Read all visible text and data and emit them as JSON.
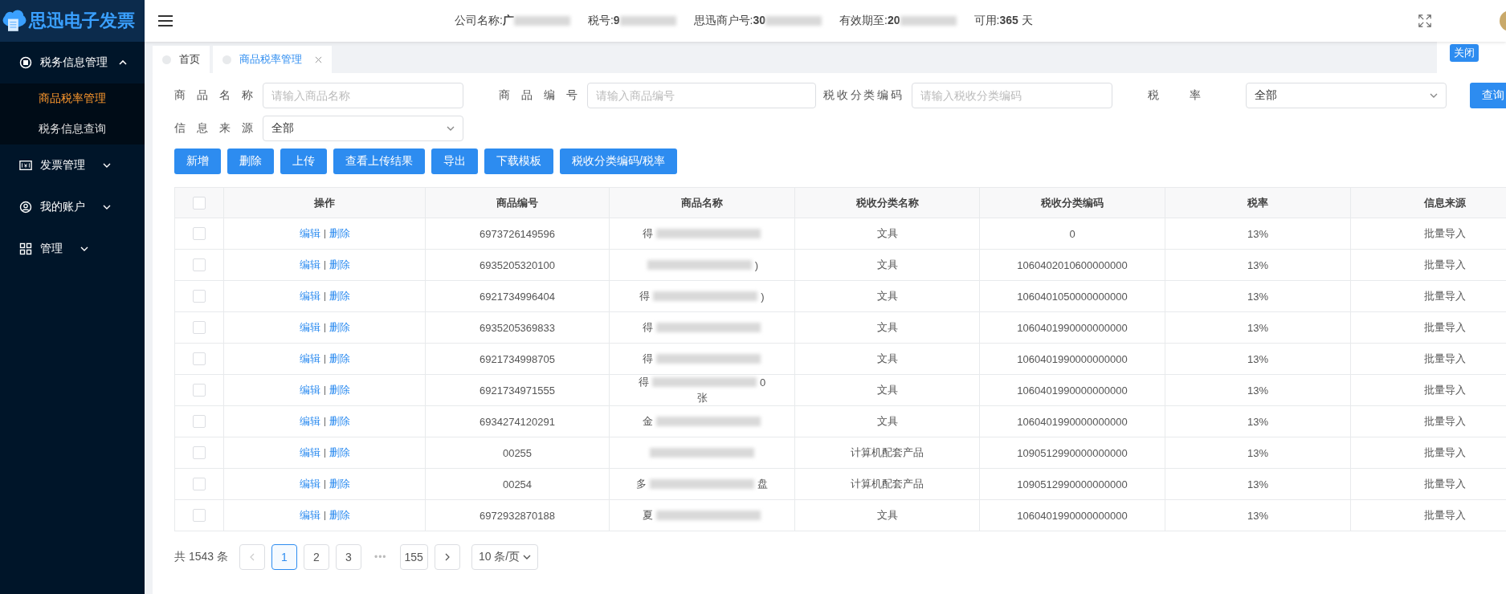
{
  "sidebar": {
    "logo": "思迅电子发票",
    "menu": [
      {
        "label": "税务信息管理",
        "kind": "tax",
        "expanded": true,
        "children": [
          {
            "label": "商品税率管理",
            "selected": true
          },
          {
            "label": "税务信息查询",
            "selected": false
          }
        ]
      },
      {
        "label": "发票管理",
        "kind": "invoice",
        "expanded": false
      },
      {
        "label": "我的账户",
        "kind": "account",
        "expanded": false
      },
      {
        "label": "管理",
        "kind": "grid",
        "expanded": false
      }
    ]
  },
  "header": {
    "info": [
      {
        "label": "公司名称:",
        "value": "广",
        "redacted": true
      },
      {
        "label": "税号:",
        "value": "9",
        "redacted": true
      },
      {
        "label": "思迅商户号:",
        "value": "30",
        "redacted": true
      },
      {
        "label": "有效期至:",
        "value": "20",
        "redacted": true
      },
      {
        "label": "可用:",
        "value": "365",
        "suffix": "天",
        "redacted": false
      }
    ]
  },
  "tabs": [
    {
      "label": "首页",
      "selected": false,
      "closable": false
    },
    {
      "label": "商品税率管理",
      "selected": true,
      "closable": true
    }
  ],
  "close_all_button": "关闭",
  "filters": [
    {
      "label": "商品名称",
      "kind": "input",
      "placeholder": "请输入商品名称"
    },
    {
      "label": "商品编号",
      "kind": "input",
      "placeholder": "请输入商品编号"
    },
    {
      "label": "税收分类编码",
      "kind": "input",
      "placeholder": "请输入税收分类编码"
    },
    {
      "label": "税率",
      "kind": "select",
      "value": "全部"
    },
    {
      "label": "信息来源",
      "kind": "select",
      "value": "全部"
    }
  ],
  "search_button": "查询",
  "actions": [
    "新增",
    "删除",
    "上传",
    "查看上传结果",
    "导出",
    "下载模板",
    "税收分类编码/税率"
  ],
  "table": {
    "all_checked": false,
    "columns": [
      "操作",
      "商品编号",
      "商品名称",
      "税收分类名称",
      "税收分类编码",
      "税率",
      "信息来源"
    ],
    "rows": [
      {
        "checked": false,
        "ops": [
          "编辑",
          "删除"
        ],
        "code": "6973726149596",
        "name_start": "得",
        "name_redacted": true,
        "category": "文具",
        "tax_code": "0",
        "rate": "13%",
        "source": "批量导入"
      },
      {
        "checked": false,
        "ops": [
          "编辑",
          "删除"
        ],
        "code": "6935205320100",
        "name_end": ")",
        "name_redacted": true,
        "category": "文具",
        "tax_code": "1060402010600000000",
        "rate": "13%",
        "source": "批量导入"
      },
      {
        "checked": false,
        "ops": [
          "编辑",
          "删除"
        ],
        "code": "6921734996404",
        "name_start": "得",
        "name_end": ")",
        "name_redacted": true,
        "category": "文具",
        "tax_code": "1060401050000000000",
        "rate": "13%",
        "source": "批量导入"
      },
      {
        "checked": false,
        "ops": [
          "编辑",
          "删除"
        ],
        "code": "6935205369833",
        "name_start": "得",
        "name_redacted": true,
        "category": "文具",
        "tax_code": "1060401990000000000",
        "rate": "13%",
        "source": "批量导入"
      },
      {
        "checked": false,
        "ops": [
          "编辑",
          "删除"
        ],
        "code": "6921734998705",
        "name_start": "得",
        "name_redacted": true,
        "category": "文具",
        "tax_code": "1060401990000000000",
        "rate": "13%",
        "source": "批量导入"
      },
      {
        "checked": false,
        "ops": [
          "编辑",
          "删除"
        ],
        "code": "6921734971555",
        "name_start": "得",
        "name_end": "0",
        "name_line2": "张",
        "name_redacted": true,
        "category": "文具",
        "tax_code": "1060401990000000000",
        "rate": "13%",
        "source": "批量导入"
      },
      {
        "checked": false,
        "ops": [
          "编辑",
          "删除"
        ],
        "code": "6934274120291",
        "name_start": "金",
        "name_redacted": true,
        "category": "文具",
        "tax_code": "1060401990000000000",
        "rate": "13%",
        "source": "批量导入"
      },
      {
        "checked": false,
        "ops": [
          "编辑",
          "删除"
        ],
        "code": "00255",
        "name_redacted": true,
        "category": "计算机配套产品",
        "tax_code": "1090512990000000000",
        "rate": "13%",
        "source": "批量导入"
      },
      {
        "checked": false,
        "ops": [
          "编辑",
          "删除"
        ],
        "code": "00254",
        "name_start": "多",
        "name_end": "盘",
        "name_redacted": true,
        "category": "计算机配套产品",
        "tax_code": "1090512990000000000",
        "rate": "13%",
        "source": "批量导入"
      },
      {
        "checked": false,
        "ops": [
          "编辑",
          "删除"
        ],
        "code": "6972932870188",
        "name_start": "夏",
        "name_redacted": true,
        "category": "文具",
        "tax_code": "1060401990000000000",
        "rate": "13%",
        "source": "批量导入"
      }
    ]
  },
  "pagination": {
    "total": "共 1543 条",
    "prev_disabled": true,
    "pages": [
      {
        "label": "1",
        "kind": "page",
        "selected": true
      },
      {
        "label": "2",
        "kind": "page",
        "selected": false
      },
      {
        "label": "3",
        "kind": "page",
        "selected": false
      },
      {
        "label": "•••",
        "kind": "ellipsis"
      },
      {
        "label": "155",
        "kind": "page",
        "selected": false
      }
    ],
    "page_size": "10 条/页"
  }
}
